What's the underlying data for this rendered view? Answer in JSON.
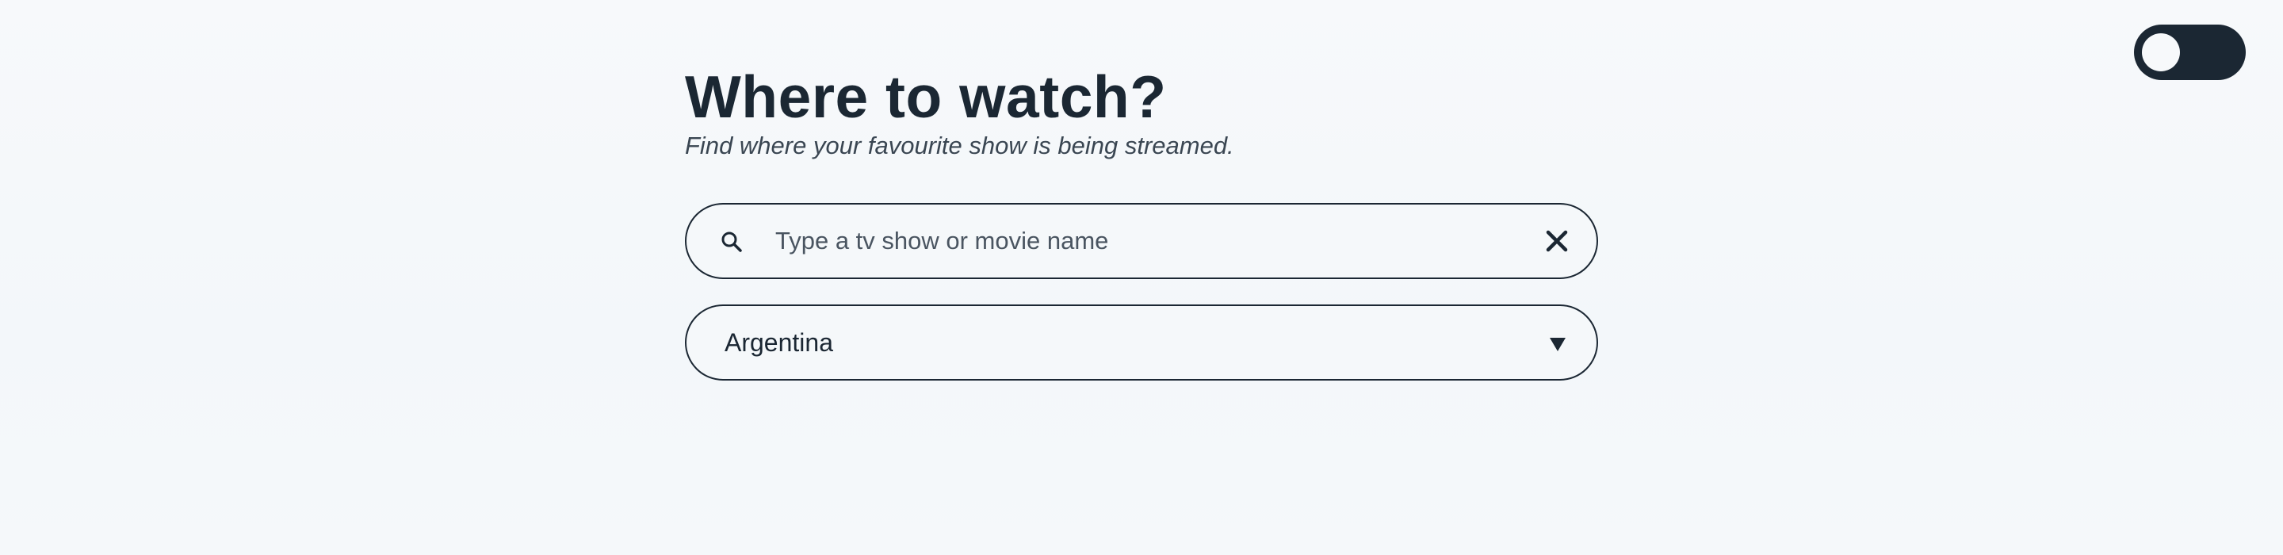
{
  "header": {
    "title": "Where to watch?",
    "subtitle": "Find where your favourite show is being streamed."
  },
  "search": {
    "placeholder": "Type a tv show or movie name",
    "value": "",
    "icon": "search-icon",
    "clear_icon": "close-icon"
  },
  "country_select": {
    "selected": "Argentina",
    "icon": "triangle-down-icon"
  },
  "theme_toggle": {
    "state": "off",
    "icon": "toggle-switch"
  },
  "colors": {
    "background": "#f5f8fa",
    "text": "#1b2733",
    "accent": "#1b2733"
  }
}
